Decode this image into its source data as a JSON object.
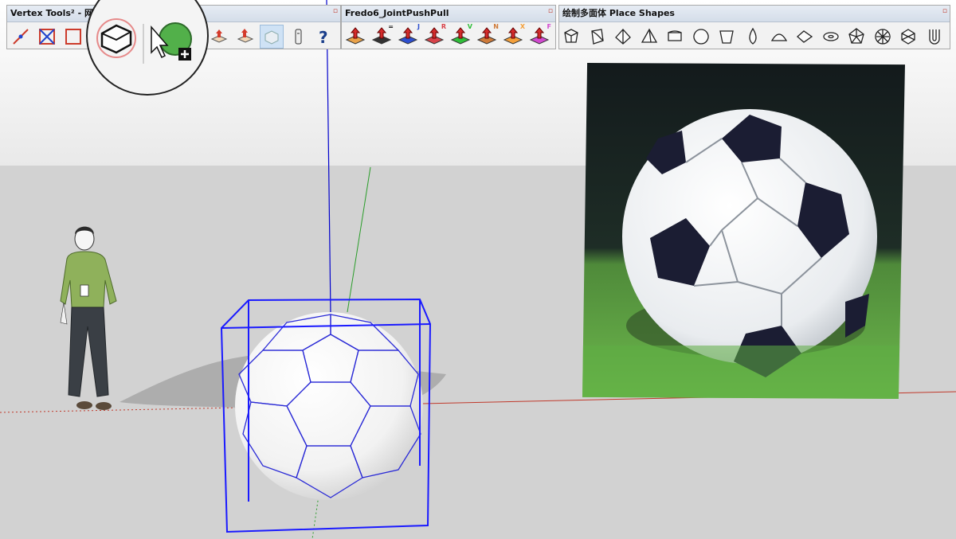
{
  "toolbars": {
    "vertex": {
      "title": "Vertex Tools² - 网"
    },
    "fredo": {
      "title": "Fredo6_JointPushPull"
    },
    "shapes": {
      "title": "绘制多面体 Place Shapes"
    }
  },
  "fredo_badges": [
    "=",
    "J",
    "R",
    "V",
    "N",
    "X",
    "F"
  ],
  "icons": {
    "vertex": [
      "move-vertex-icon",
      "scale-vertex-icon",
      "rotate-vertex-icon",
      "box-icon",
      "pushpull-icon",
      "extrude-icon",
      "smooth-icon",
      "info-icon",
      "help-icon"
    ],
    "fredo": [
      "joint-pushpull-icon",
      "vector-pushpull-icon",
      "normal-pushpull-icon",
      "joint-pushpull-j-icon",
      "round-pushpull-icon",
      "vector-pushpull-v-icon",
      "normal-pushpull-n-icon",
      "extrude-x-icon",
      "follow-pushpull-icon"
    ],
    "shapes": [
      "box-shape-icon",
      "prism-shape-icon",
      "pyramid-shape-icon",
      "tetrahedron-shape-icon",
      "cylinder-shape-icon",
      "sphere-shape-icon",
      "cup-shape-icon",
      "drop-shape-icon",
      "dome-shape-icon",
      "lens-shape-icon",
      "torus-shape-icon",
      "polyhedron-shape-icon",
      "geodesic-shape-icon",
      "icosphere-shape-icon",
      "u-shape-icon"
    ]
  },
  "colors": {
    "axis_blue": "#0000cc",
    "axis_green": "#2a9d2a",
    "axis_red": "#c0392b",
    "selection_box": "#1a1aff",
    "sky": "#ffffff",
    "ground": "#d2d2d2"
  }
}
